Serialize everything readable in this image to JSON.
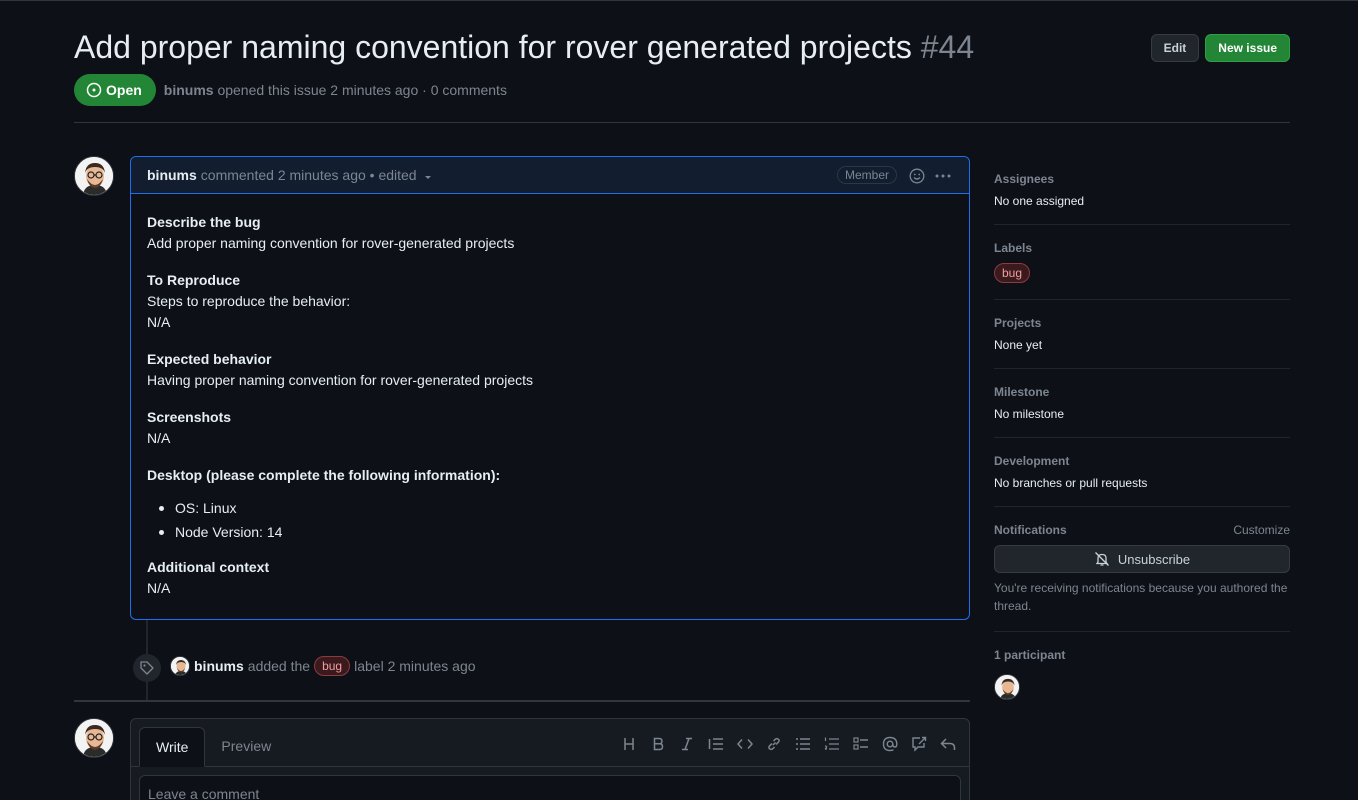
{
  "issue": {
    "title": "Add proper naming convention for rover generated projects",
    "number": "#44",
    "state": "Open",
    "author": "binums",
    "meta": "opened this issue 2 minutes ago · 0 comments"
  },
  "actions": {
    "edit": "Edit",
    "new_issue": "New issue"
  },
  "comment": {
    "author": "binums",
    "when": "commented 2 minutes ago • edited",
    "role_badge": "Member",
    "sections": [
      {
        "heading": "Describe the bug",
        "text": "Add proper naming convention for rover-generated projects"
      },
      {
        "heading": "To Reproduce",
        "text": "Steps to reproduce the behavior:",
        "text2": "N/A"
      },
      {
        "heading": "Expected behavior",
        "text": "Having proper naming convention for rover-generated projects"
      },
      {
        "heading": "Screenshots",
        "text": "N/A"
      },
      {
        "heading": "Desktop (please complete the following information):"
      },
      {
        "heading": "Additional context",
        "text": "N/A"
      }
    ],
    "desktop_items": [
      "OS: Linux",
      "Node Version: 14"
    ]
  },
  "timeline_event": {
    "actor": "binums",
    "prefix": "added the",
    "label": "bug",
    "suffix": "label 2 minutes ago"
  },
  "new_comment": {
    "tabs": [
      "Write",
      "Preview"
    ],
    "placeholder": "Leave a comment",
    "toolbar_icons": [
      "heading-icon",
      "bold-icon",
      "italic-icon",
      "quote-icon",
      "code-icon",
      "link-icon",
      "unordered-list-icon",
      "ordered-list-icon",
      "task-list-icon",
      "mention-icon",
      "cross-reference-icon",
      "reply-icon"
    ]
  },
  "sidebar": {
    "assignees": {
      "title": "Assignees",
      "value": "No one assigned"
    },
    "labels": {
      "title": "Labels",
      "value": "bug"
    },
    "projects": {
      "title": "Projects",
      "value": "None yet"
    },
    "milestone": {
      "title": "Milestone",
      "value": "No milestone"
    },
    "development": {
      "title": "Development",
      "value": "No branches or pull requests"
    },
    "notifications": {
      "title": "Notifications",
      "customize": "Customize",
      "button": "Unsubscribe",
      "note": "You're receiving notifications because you authored the thread."
    },
    "participants": {
      "title": "1 participant"
    }
  },
  "colors": {
    "open_green": "#238636",
    "accent_blue": "#1f6feb",
    "bug_label": "#f29ca1"
  }
}
